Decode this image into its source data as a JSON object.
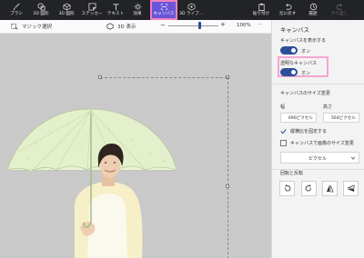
{
  "toolbar": {
    "items": [
      {
        "label": "ブラシ",
        "icon": "brush-icon"
      },
      {
        "label": "2D 図形",
        "icon": "2d-shapes-icon"
      },
      {
        "label": "3D 図形",
        "icon": "3d-shapes-icon"
      },
      {
        "label": "ステッカー",
        "icon": "stickers-icon"
      },
      {
        "label": "テキスト",
        "icon": "text-icon"
      },
      {
        "label": "効果",
        "icon": "effects-icon"
      },
      {
        "label": "キャンバス",
        "icon": "canvas-icon"
      },
      {
        "label": "3D ライブ...",
        "icon": "3d-library-icon"
      }
    ],
    "right_items": [
      {
        "label": "貼り付け",
        "icon": "paste-icon"
      },
      {
        "label": "元に戻す",
        "icon": "undo-icon"
      },
      {
        "label": "履歴",
        "icon": "history-icon"
      },
      {
        "label": "やり直し",
        "icon": "redo-icon"
      }
    ],
    "selected": "キャンバス",
    "selection_highlight_color": "#f07fc0",
    "selected_bg_color": "#6a55d8"
  },
  "subbar": {
    "magic_select_label": "マジック選択",
    "view_3d_label": "3D 表示",
    "zoom_minus": "−",
    "zoom_plus": "+",
    "zoom_value": "100%",
    "zoom_fraction": 0.62,
    "more_label": "···"
  },
  "panel": {
    "title": "キャンバス",
    "show_canvas_label": "キャンバスを表示する",
    "show_canvas_state": "オン",
    "transparent_canvas_label": "透明なキャンバス",
    "transparent_canvas_state": "オン",
    "resize_section_label": "キャンバスのサイズ変更",
    "width_label": "幅",
    "height_label": "高さ",
    "width_value": "696ピクセル",
    "height_value": "564ピクセル",
    "lock_aspect_label": "縦横比を固定する",
    "lock_aspect_checked": true,
    "resize_image_label": "キャンバスで画像のサイズ変更",
    "resize_image_checked": false,
    "unit_value": "ピクセル",
    "rotate_section_label": "回転と反転",
    "rotate_buttons": [
      "rotate-left-icon",
      "rotate-right-icon",
      "flip-vertical-icon",
      "flip-horizontal-icon"
    ],
    "accent_color": "#2b4f9a",
    "highlight_color": "#f6a5d3"
  }
}
